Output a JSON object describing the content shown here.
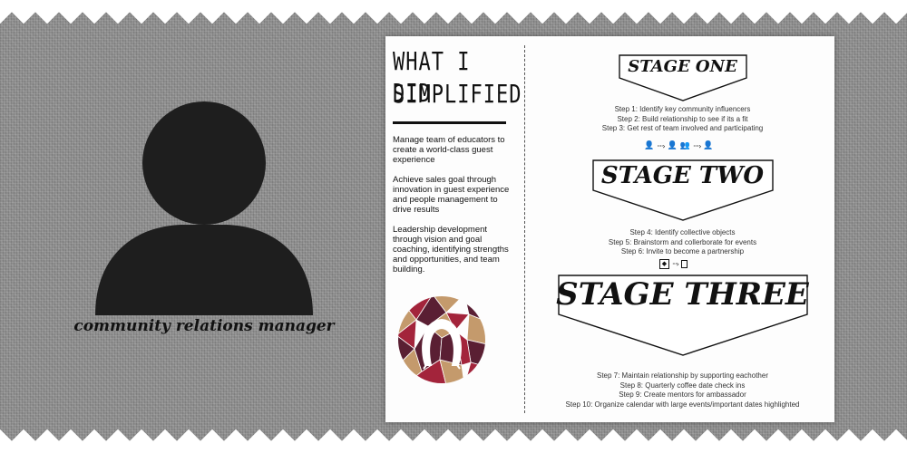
{
  "role": "community relations manager",
  "headline": [
    "WHAT I DID",
    "SIMPLIFIED"
  ],
  "bullets": [
    "Manage team of educators to create a world-class guest experience",
    "Achieve sales goal through innovation in guest experience and people management to drive results",
    "Leadership development through vision and goal coaching, identifying strengths and opportunities, and team building."
  ],
  "stages": [
    {
      "title": "STAGE ONE",
      "steps": [
        "Step 1: Identify key community influencers",
        "Step 2: Build relationship to see if its a fit",
        "Step 3: Get rest of team involved and participating"
      ]
    },
    {
      "title": "STAGE TWO",
      "steps": [
        "Step 4: Identify collective objects",
        "Step 5: Brainstorm and collerborate for events",
        "Step 6: Invite to become a partnership"
      ]
    },
    {
      "title": "STAGE THREE",
      "steps": [
        "Step 7: Maintain relationship by supporting eachother",
        "Step 8: Quarterly coffee date check ins",
        "Step 9: Create mentors for ambassador",
        "Step 10: Organize calendar with large events/important dates highlighted"
      ]
    }
  ],
  "icons": {
    "avatar": "person-silhouette-icon",
    "logo": "mosaic-logo",
    "flow1": [
      "person-icon",
      "person-icon",
      "group-icon",
      "person-icon"
    ],
    "flow2": [
      "puzzle-icon",
      "document-icon"
    ]
  },
  "colors": {
    "background": "#8c8c8c",
    "silhouette": "#1e1e1e",
    "card": "#fdfdfd",
    "logo_red": "#a3243b",
    "logo_maroon": "#5a1f33",
    "logo_tan": "#c49a6c"
  }
}
